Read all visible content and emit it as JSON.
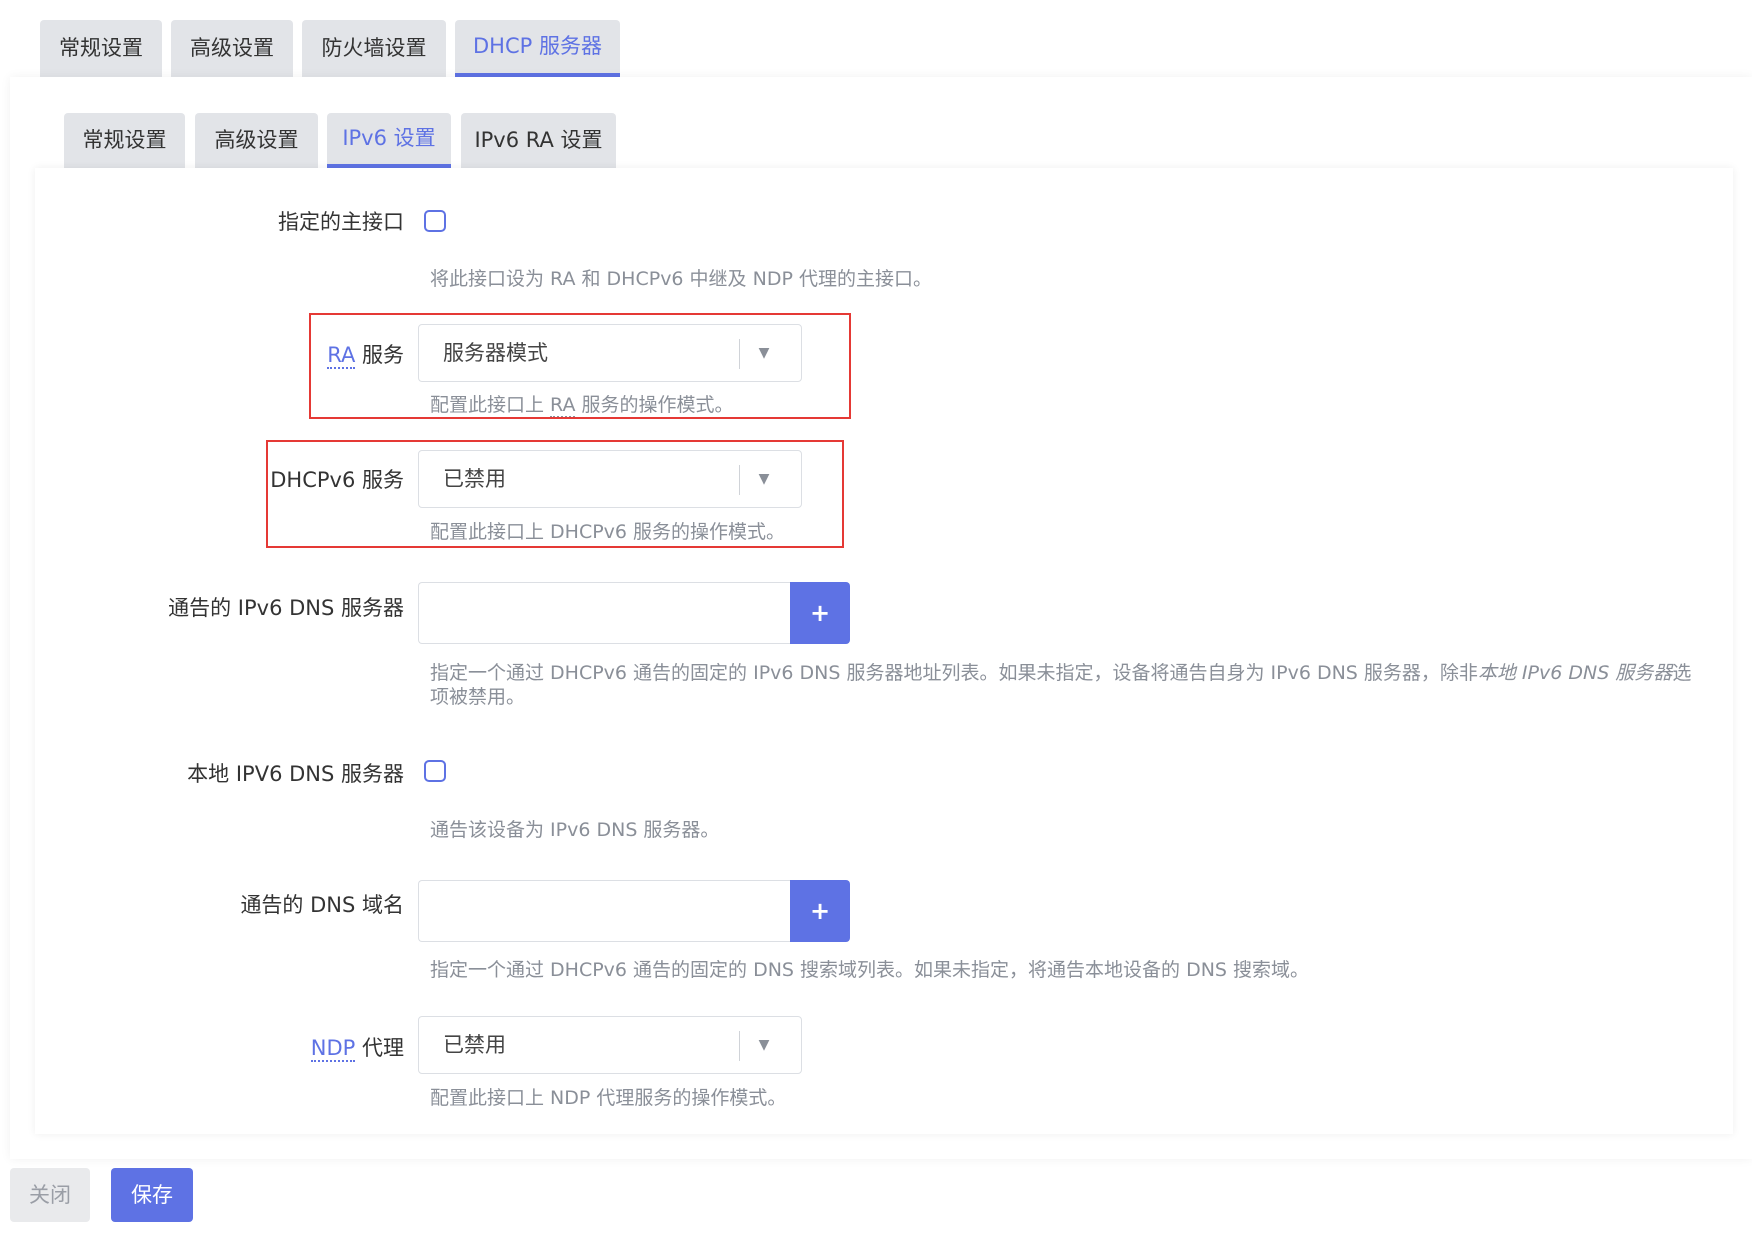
{
  "top_tabs": [
    {
      "label": "常规设置"
    },
    {
      "label": "高级设置"
    },
    {
      "label": "防火墙设置"
    },
    {
      "label": "DHCP 服务器",
      "active": true
    }
  ],
  "sub_tabs": [
    {
      "label": "常规设置"
    },
    {
      "label": "高级设置"
    },
    {
      "label": "IPv6 设置",
      "active": true
    },
    {
      "label": "IPv6 RA 设置"
    }
  ],
  "fields": {
    "master": {
      "label": "指定的主接口",
      "checked": false,
      "desc": "将此接口设为 RA 和 DHCPv6 中继及 NDP 代理的主接口。"
    },
    "ra_service": {
      "label_abbr": "RA",
      "label_rest": " 服务",
      "value": "服务器模式",
      "desc_prefix": "配置此接口上 ",
      "desc_abbr": "RA",
      "desc_suffix": " 服务的操作模式。"
    },
    "dhcpv6_service": {
      "label": "DHCPv6 服务",
      "value": "已禁用",
      "desc": "配置此接口上 DHCPv6 服务的操作模式。"
    },
    "ipv6_dns": {
      "label": "通告的 IPv6 DNS 服务器",
      "value": "",
      "add_label": "+",
      "desc_prefix": "指定一个通过 DHCPv6 通告的固定的 IPv6 DNS 服务器地址列表。如果未指定，设备将通告自身为 IPv6 DNS 服务器，除非",
      "desc_em": "本地 IPv6 DNS 服务器",
      "desc_suffix": "选项被禁用。"
    },
    "local_dns": {
      "label": "本地 IPV6 DNS 服务器",
      "checked": false,
      "desc": "通告该设备为 IPv6 DNS 服务器。"
    },
    "dns_domain": {
      "label": "通告的 DNS 域名",
      "value": "",
      "add_label": "+",
      "desc": "指定一个通过 DHCPv6 通告的固定的 DNS 搜索域列表。如果未指定，将通告本地设备的 DNS 搜索域。"
    },
    "ndp_proxy": {
      "label_abbr": "NDP",
      "label_rest": " 代理",
      "value": "已禁用",
      "desc": "配置此接口上 NDP 代理服务的操作模式。"
    }
  },
  "icons": {
    "dropdown": "▼",
    "highlight_color": "#e53935",
    "accent_color": "#5e72e4"
  },
  "footer": {
    "close_label": "关闭",
    "save_label": "保存"
  }
}
